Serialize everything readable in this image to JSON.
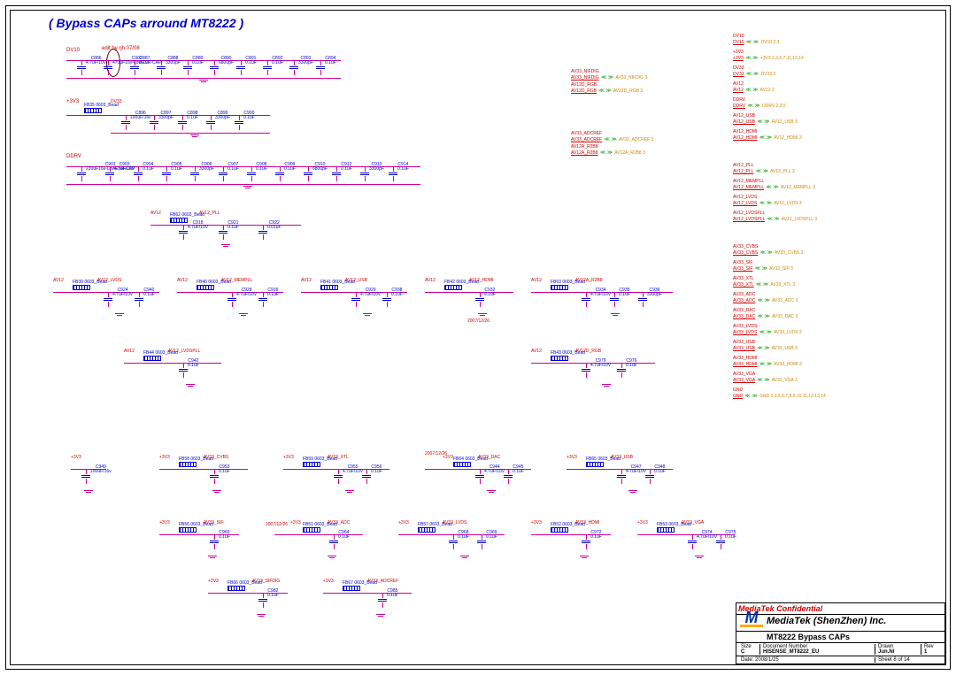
{
  "title": "( Bypass CAPs arround MT8222 )",
  "edit_note": "edit by rjh 07/08",
  "confidential": "MediaTek Confidential",
  "company": "MediaTek (ShenZhen) Inc.",
  "sheet_title": "MT8222 Bypass CAPs",
  "doc_label": "Document Number",
  "doc_number": "HISENSE_MT8222_EU",
  "size_label": "Size",
  "size": "C",
  "rev_label": "Rev",
  "rev": "1",
  "date_label": "Date:",
  "date": "2008/1/25",
  "drawn_label": "Drawn",
  "drawn": "Jun.Ni",
  "sheet_label": "Sheet",
  "sheet": "8",
  "of_label": "of",
  "of": "14",
  "dates": {
    "d1": "2007/12/26",
    "d2": "2007/12/26",
    "d3": "2007/12/26"
  },
  "rails": {
    "r1": "DV10",
    "r2": "+3V3",
    "r3": "DDRV",
    "r4": "AV12",
    "r5": "AV12_PLL",
    "r6": "AV12_LVDS",
    "r7": "AV12_MEMPLL",
    "r8": "AV12_USB",
    "r9": "AV12_HDMI",
    "r10": "AV12A_R2B8",
    "r11": "AV12_LVDSPLL",
    "r12": "AV12D_RGB",
    "r13": "AV33_CVBS",
    "r14": "AV33_XTL",
    "r15": "AV33_DAC",
    "r16": "AV33_USB",
    "r17": "AV33_SIF",
    "r18": "AV33_ADC",
    "r19": "AV33_LVDS",
    "r20": "AV33_HDMI",
    "r21": "AV33_VGA",
    "r22": "AV33_SIFDIG",
    "r23": "AV33_ADCREF",
    "r24": "AV33_NIFDIG",
    "r25": "AV33_ADCREF",
    "r26": "AV12D_RGB",
    "r27": "AV12A_R2B8"
  },
  "caps": {
    "row1": [
      {
        "ref": "C886",
        "val": "4.7uF/10V"
      },
      {
        "ref": "C902",
        "val": "470uF16v-LowESR-CAP"
      },
      {
        "ref": "C887",
        "val": "0.1uF"
      },
      {
        "ref": "C888",
        "val": "3300pF"
      },
      {
        "ref": "C889",
        "val": "0.1uF"
      },
      {
        "ref": "C890",
        "val": "6800pF"
      },
      {
        "ref": "C891",
        "val": "0.1uF"
      },
      {
        "ref": "C892",
        "val": "0.1uF"
      },
      {
        "ref": "C893",
        "val": "3300pF"
      },
      {
        "ref": "C894",
        "val": "0.1uF"
      }
    ],
    "row2": [
      {
        "ref": "C896",
        "val": "100uF/16v"
      },
      {
        "ref": "C897",
        "val": "3300pF"
      },
      {
        "ref": "C898",
        "val": "0.1uF"
      },
      {
        "ref": "C899",
        "val": "3300pF"
      },
      {
        "ref": "C900",
        "val": "0.1uF"
      }
    ],
    "row3": [
      {
        "ref": "C901",
        "val": "220uF16v-LowESR-CAP"
      },
      {
        "ref": "C903",
        "val": "4.7uF/10V"
      },
      {
        "ref": "C904",
        "val": "0.1uF"
      },
      {
        "ref": "C905",
        "val": "0.1uF"
      },
      {
        "ref": "C906",
        "val": "3300pF"
      },
      {
        "ref": "C907",
        "val": "0.1uF"
      },
      {
        "ref": "C908",
        "val": "0.1uF"
      },
      {
        "ref": "C909",
        "val": "0.1uF"
      },
      {
        "ref": "C910",
        "val": "6800pF"
      },
      {
        "ref": "C912",
        "val": "0.1uF"
      },
      {
        "ref": "C913",
        "val": "3300pF"
      },
      {
        "ref": "C914",
        "val": "0.1uF"
      }
    ],
    "row4": [
      {
        "ref": "C918",
        "val": "4.7uF/10V"
      },
      {
        "ref": "C921",
        "val": "0.1uF"
      },
      {
        "ref": "C922",
        "val": "0.01uF"
      }
    ],
    "row5a": [
      {
        "ref": "C924",
        "val": "4.7uF/10V"
      },
      {
        "ref": "C940",
        "val": "0.1uF"
      }
    ],
    "row5b": [
      {
        "ref": "C928",
        "val": "4.7uF/10V"
      },
      {
        "ref": "C939",
        "val": "0.1uF"
      }
    ],
    "row5c": [
      {
        "ref": "C929",
        "val": "4.7uF/10V"
      },
      {
        "ref": "C938",
        "val": "0.1uF"
      }
    ],
    "row5d": [
      {
        "ref": "C932",
        "val": "0.1uF"
      }
    ],
    "row5e": [
      {
        "ref": "C934",
        "val": "4.7uF/10V"
      },
      {
        "ref": "C935",
        "val": "0.1uF"
      },
      {
        "ref": "C936",
        "val": "3300pF"
      }
    ],
    "row6a": [
      {
        "ref": "C942",
        "val": "0.1uF"
      }
    ],
    "row6b": [
      {
        "ref": "C979",
        "val": "4.7uF/10V"
      },
      {
        "ref": "C976",
        "val": "0.1uF"
      }
    ],
    "row7": [
      {
        "ref": "C949",
        "val": "100uF/16v"
      }
    ],
    "row8a": [
      {
        "ref": "C953",
        "val": "0.1uF"
      }
    ],
    "row8b": [
      {
        "ref": "C955",
        "val": "4.7uF/10V"
      },
      {
        "ref": "C956",
        "val": "0.1uF"
      }
    ],
    "row8c": [
      {
        "ref": "C944",
        "val": "4.7uF/10V"
      },
      {
        "ref": "C945",
        "val": "0.1uF"
      }
    ],
    "row8d": [
      {
        "ref": "C947",
        "val": "4.7uF/10V"
      },
      {
        "ref": "C948",
        "val": "0.1uF"
      }
    ],
    "row9a": [
      {
        "ref": "C960",
        "val": "0.1uF"
      }
    ],
    "row9b": [
      {
        "ref": "C964",
        "val": "0.1uF"
      }
    ],
    "row9c": [
      {
        "ref": "C968",
        "val": "0.1uF"
      },
      {
        "ref": "C969",
        "val": "0.1uF"
      }
    ],
    "row9d": [
      {
        "ref": "C972",
        "val": "0.1uF"
      }
    ],
    "row9e": [
      {
        "ref": "C974",
        "val": "4.7uF/10V"
      },
      {
        "ref": "C975",
        "val": "0.1uF"
      }
    ],
    "row10a": [
      {
        "ref": "C982",
        "val": "0.1uF"
      }
    ],
    "row10b": [
      {
        "ref": "C985",
        "val": "0.1uF"
      }
    ]
  },
  "beads": {
    "fb35": {
      "ref": "FB35",
      "val": "0603_Bead",
      "net": "DV33"
    },
    "fb62": {
      "ref": "FB62",
      "val": "0603_Bead",
      "net": ""
    },
    "fb39": {
      "ref": "FB39",
      "val": "0603_Bead"
    },
    "fb40": {
      "ref": "FB40",
      "val": "0603_Bead"
    },
    "fb41": {
      "ref": "FB41",
      "val": "0603_Bead"
    },
    "fb42": {
      "ref": "FB42",
      "val": "0603_Bead"
    },
    "fb63": {
      "ref": "FB63",
      "val": "0603_Bead"
    },
    "fb44": {
      "ref": "FB44",
      "val": "0603_Bead"
    },
    "fb43": {
      "ref": "FB43",
      "val": "0603_Bead"
    },
    "fb58": {
      "ref": "FB58",
      "val": "0603_Bead"
    },
    "fb59": {
      "ref": "FB59",
      "val": "0603_Bead"
    },
    "fb64": {
      "ref": "FB64",
      "val": "0603_Bead"
    },
    "fb65": {
      "ref": "FB65",
      "val": "0603_Bead"
    },
    "fb56": {
      "ref": "FB56",
      "val": "0603_Bead"
    },
    "fb51": {
      "ref": "FB51",
      "val": "0603_Bead"
    },
    "fb57": {
      "ref": "FB57",
      "val": "0603_Bead"
    },
    "fb52": {
      "ref": "FB52",
      "val": "0603_Bead"
    },
    "fb53": {
      "ref": "FB53",
      "val": "0603_Bead"
    },
    "fb66": {
      "ref": "FB66",
      "val": "0603_Bead"
    },
    "fb67": {
      "ref": "FB67",
      "val": "0603_Bead"
    }
  },
  "offpage_left": [
    {
      "net": "AV33_NIFDIG",
      "pages": "3",
      "label": "AV33_NIFDIG"
    },
    {
      "net": "AV12D_RGB",
      "pages": "3",
      "label": "AV12D_RGB"
    },
    {
      "net": "AV33_ADCREF",
      "pages": "3",
      "label": "AV33_ADCREF"
    },
    {
      "net": "AV12A_R2B8",
      "pages": "3",
      "label": "AV12A_R2B8"
    }
  ],
  "offpage_right": [
    {
      "net": "DV10",
      "pages": "2,3",
      "label": "DV10"
    },
    {
      "net": "+3V3",
      "pages": "2,3,6,7,11,13,14",
      "label": "+3V3"
    },
    {
      "net": "DV33",
      "pages": "3",
      "label": "DV33"
    },
    {
      "net": "AV12",
      "pages": "2",
      "label": "AV12"
    },
    {
      "net": "DDRV",
      "pages": "2,3,5",
      "label": "DDRV"
    },
    {
      "net": "AV12_USB",
      "pages": "3",
      "label": "AV12_USB"
    },
    {
      "net": "AV12_HDMI",
      "pages": "3",
      "label": "AV12_HDMI"
    },
    {
      "net": "AV12_PLL",
      "pages": "3",
      "label": "AV12_PLL"
    },
    {
      "net": "AV12_MEMPLL",
      "pages": "3",
      "label": "AV12_MEMPLL"
    },
    {
      "net": "AV12_LVDS",
      "pages": "3",
      "label": "AV12_LVDS"
    },
    {
      "net": "AV12_LVDSPLL",
      "pages": "3",
      "label": "AV12_LVDSPLL"
    },
    {
      "net": "AV33_CVBS",
      "pages": "3",
      "label": "AV33_CVBS"
    },
    {
      "net": "AV33_SIF",
      "pages": "3",
      "label": "AV33_SIF"
    },
    {
      "net": "AV33_XTL",
      "pages": "3",
      "label": "AV33_XTL"
    },
    {
      "net": "AV33_ADC",
      "pages": "3",
      "label": "AV33_ADC"
    },
    {
      "net": "AV33_DAC",
      "pages": "3",
      "label": "AV33_DAC"
    },
    {
      "net": "AV33_LVDS",
      "pages": "3",
      "label": "AV33_LVDS"
    },
    {
      "net": "AV33_USB",
      "pages": "3",
      "label": "AV33_USB"
    },
    {
      "net": "AV33_HDMI",
      "pages": "3",
      "label": "AV33_HDMI"
    },
    {
      "net": "AV33_VGA",
      "pages": "3",
      "label": "AV33_VGA"
    },
    {
      "net": "GND",
      "pages": "2,3,5,6,7,8,9,10,11,12,13,14",
      "label": "GND"
    }
  ]
}
